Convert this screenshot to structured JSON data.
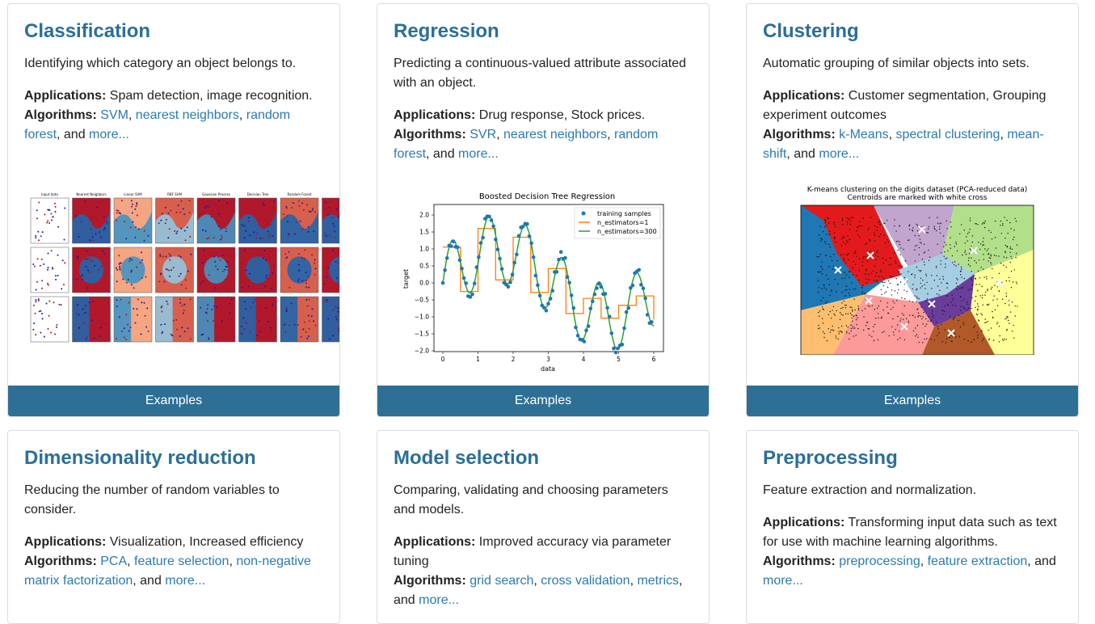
{
  "cards": [
    {
      "title": "Classification",
      "description": "Identifying which category an object belongs to.",
      "applications_label": "Applications:",
      "applications": "Spam detection, image recognition.",
      "algorithms_label": "Algorithms:",
      "links": [
        "SVM",
        "nearest neighbors",
        "random forest",
        "more..."
      ],
      "figure_titles": [
        "Input data",
        "Nearest Neighbors",
        "Linear SVM",
        "RBF SVM",
        "Gaussian Process",
        "Decision Tree",
        "Random Forest"
      ],
      "button": "Examples"
    },
    {
      "title": "Regression",
      "description": "Predicting a continuous-valued attribute associated with an object.",
      "applications_label": "Applications:",
      "applications": "Drug response, Stock prices.",
      "algorithms_label": "Algorithms:",
      "links": [
        "SVR",
        "nearest neighbors",
        "random forest",
        "more..."
      ],
      "button": "Examples"
    },
    {
      "title": "Clustering",
      "description": "Automatic grouping of similar objects into sets.",
      "applications_label": "Applications:",
      "applications": "Customer segmentation, Grouping experiment outcomes",
      "algorithms_label": "Algorithms:",
      "links": [
        "k-Means",
        "spectral clustering",
        "mean-shift",
        "more..."
      ],
      "figure_title_1": "K-means clustering on the digits dataset (PCA-reduced data)",
      "figure_title_2": "Centroids are marked with white cross",
      "button": "Examples"
    },
    {
      "title": "Dimensionality reduction",
      "description": "Reducing the number of random variables to consider.",
      "applications_label": "Applications:",
      "applications": "Visualization, Increased efficiency",
      "algorithms_label": "Algorithms:",
      "links": [
        "PCA",
        "feature selection",
        "non-negative matrix factorization",
        "more..."
      ]
    },
    {
      "title": "Model selection",
      "description": "Comparing, validating and choosing parameters and models.",
      "applications_label": "Applications:",
      "applications": "Improved accuracy via parameter tuning",
      "algorithms_label": "Algorithms:",
      "links": [
        "grid search",
        "cross validation",
        "metrics",
        "more..."
      ]
    },
    {
      "title": "Preprocessing",
      "description": "Feature extraction and normalization.",
      "applications_label": "Applications:",
      "applications": "Transforming input data such as text for use with machine learning algorithms.",
      "algorithms_label": "Algorithms:",
      "links": [
        "preprocessing",
        "feature extraction",
        "more..."
      ]
    }
  ],
  "connector": ", and ",
  "regression_chart": {
    "title": "Boosted Decision Tree Regression",
    "xlabel": "data",
    "ylabel": "target",
    "xticks": [
      "0",
      "1",
      "2",
      "3",
      "4",
      "5",
      "6"
    ],
    "yticks": [
      "2.0",
      "1.5",
      "1.0",
      "0.5",
      "0.0",
      "−0.5",
      "−1.0",
      "−1.5",
      "−2.0"
    ],
    "legend": [
      "training samples",
      "n_estimators=1",
      "n_estimators=300"
    ],
    "colors": {
      "samples": "#1f77b4",
      "est1": "#ff7f0e",
      "est300": "#2ca02c"
    }
  }
}
